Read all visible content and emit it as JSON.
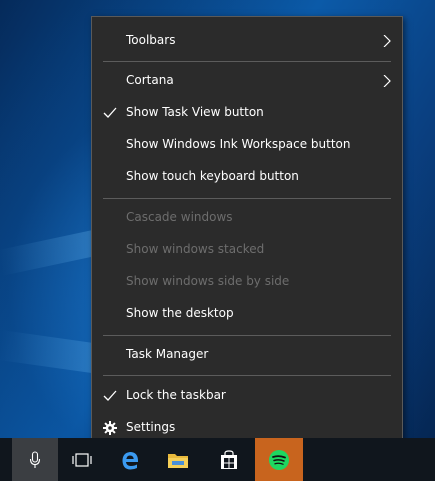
{
  "context_menu": {
    "items": [
      {
        "label": "Toolbars",
        "submenu": true,
        "checked": false,
        "disabled": false
      },
      {
        "label": "Cortana",
        "submenu": true,
        "checked": false,
        "disabled": false
      },
      {
        "label": "Show Task View button",
        "checked": true,
        "disabled": false
      },
      {
        "label": "Show Windows Ink Workspace button",
        "checked": false,
        "disabled": false
      },
      {
        "label": "Show touch keyboard button",
        "checked": false,
        "disabled": false
      },
      {
        "label": "Cascade windows",
        "checked": false,
        "disabled": true
      },
      {
        "label": "Show windows stacked",
        "checked": false,
        "disabled": true
      },
      {
        "label": "Show windows side by side",
        "checked": false,
        "disabled": true
      },
      {
        "label": "Show the desktop",
        "checked": false,
        "disabled": false
      },
      {
        "label": "Task Manager",
        "checked": false,
        "disabled": false
      },
      {
        "label": "Lock the taskbar",
        "checked": true,
        "disabled": false
      },
      {
        "label": "Settings",
        "icon": "gear-icon",
        "disabled": false
      }
    ]
  },
  "taskbar": {
    "buttons": [
      {
        "name": "microphone-icon",
        "active": true
      },
      {
        "name": "task-view-icon"
      },
      {
        "name": "edge-icon"
      },
      {
        "name": "file-explorer-icon"
      },
      {
        "name": "windows-store-icon"
      },
      {
        "name": "spotify-icon",
        "highlighted": true
      }
    ]
  },
  "colors": {
    "menu_bg": "#2b2b2b",
    "menu_text": "#ffffff",
    "menu_disabled_text": "#6d6d6d",
    "separator": "#5c5c5c",
    "taskbar_bg": "#10161d",
    "spotify_green": "#1ed760",
    "spotify_tile": "#c8641e"
  }
}
